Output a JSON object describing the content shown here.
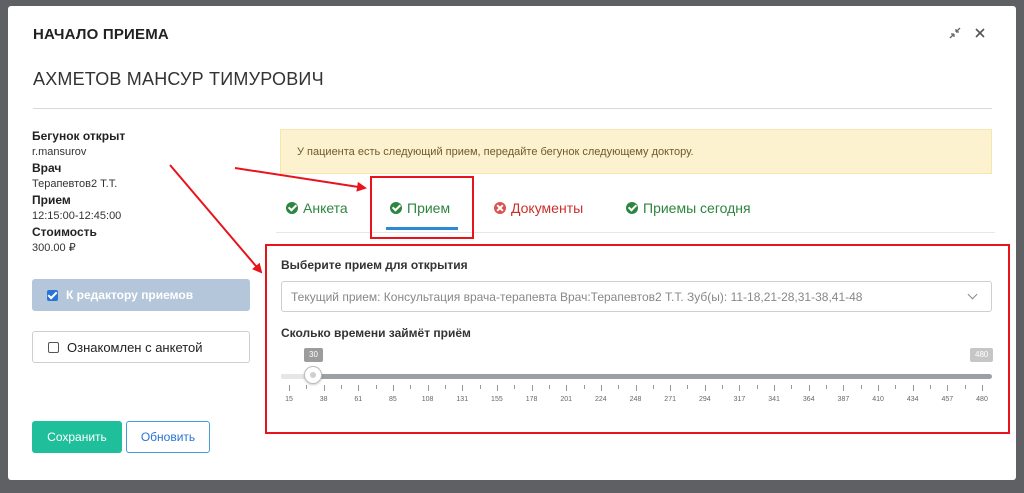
{
  "modal": {
    "title": "НАЧАЛО ПРИЕМА",
    "minimize_icon": "compress-icon",
    "close_icon": "close-icon",
    "patient_name": "АХМЕТОВ МАНСУР ТИМУРОВИЧ"
  },
  "info": [
    {
      "label": "Бегунок открыт",
      "value": "r.mansurov"
    },
    {
      "label": "Врач",
      "value": "Терапевтов2 Т.Т."
    },
    {
      "label": "Прием",
      "value": "12:15:00-12:45:00"
    },
    {
      "label": "Стоимость",
      "value": "300.00 ₽"
    }
  ],
  "buttons": {
    "editor": "К редактору приемов",
    "acknowledged": "Ознакомлен с анкетой",
    "save": "Сохранить",
    "refresh": "Обновить"
  },
  "alert": "У пациента есть следующий прием, передайте бегунок следующему доктору.",
  "tabs": [
    {
      "label": "Анкета",
      "status": "ok"
    },
    {
      "label": "Прием",
      "status": "ok",
      "active": true
    },
    {
      "label": "Документы",
      "status": "error"
    },
    {
      "label": "Приемы сегодня",
      "status": "ok"
    }
  ],
  "form": {
    "select_label": "Выберите прием для открытия",
    "select_value": "Текущий прием: Консультация врача-терапевта Врач:Терапевтов2 Т.Т. Зуб(ы): 11-18,21-28,31-38,41-48",
    "duration_label": "Сколько времени займёт приём",
    "slider": {
      "min": 15,
      "max": 480,
      "value": 30,
      "min_label": "30",
      "max_label": "480",
      "tick_labels": [
        "15",
        "38",
        "61",
        "85",
        "108",
        "131",
        "155",
        "178",
        "201",
        "224",
        "248",
        "271",
        "294",
        "317",
        "341",
        "364",
        "387",
        "410",
        "434",
        "457",
        "480"
      ]
    }
  },
  "colors": {
    "accent_blue": "#2a73d6",
    "save_green": "#1fbf9c",
    "tab_ok": "#2e8540",
    "tab_error": "#c9302c",
    "annotation_red": "#e8141c"
  }
}
